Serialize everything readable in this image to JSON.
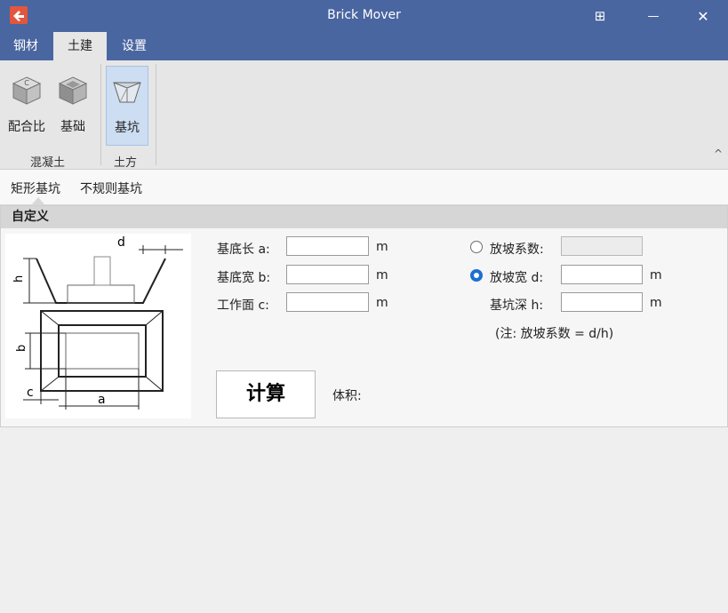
{
  "window": {
    "title": "Brick Mover",
    "restore_glyph": "⊞",
    "minimize_glyph": "—",
    "close_glyph": "✕"
  },
  "tabs": [
    {
      "label": "钢材"
    },
    {
      "label": "土建",
      "active": true
    },
    {
      "label": "设置"
    }
  ],
  "ribbon": {
    "buttons": [
      {
        "label": "配合比"
      },
      {
        "label": "基础"
      },
      {
        "label": "基坑",
        "selected": true
      }
    ],
    "groups": [
      {
        "label": "混凝土"
      },
      {
        "label": "土方"
      }
    ],
    "collapse_glyph": "^"
  },
  "subtabs": [
    {
      "label": "矩形基坑",
      "active": true
    },
    {
      "label": "不规则基坑"
    }
  ],
  "panel": {
    "header": "自定义",
    "diagram_labels": {
      "d": "d",
      "h": "h",
      "b": "b",
      "c": "c",
      "a": "a"
    },
    "fields": {
      "length": {
        "label": "基底长 a:",
        "value": "",
        "unit": "m"
      },
      "width": {
        "label": "基底宽 b:",
        "value": "",
        "unit": "m"
      },
      "workface": {
        "label": "工作面 c:",
        "value": "",
        "unit": "m"
      },
      "slope_coef": {
        "label": "放坡系数:",
        "value": "",
        "checked": false
      },
      "slope_width": {
        "label": "放坡宽 d:",
        "value": "",
        "unit": "m",
        "checked": true
      },
      "pit_depth": {
        "label": "基坑深 h:",
        "value": "",
        "unit": "m"
      }
    },
    "note": "(注: 放坡系数 = d/h)",
    "calc_button": "计算",
    "volume_label": "体积:"
  },
  "colors": {
    "titlebar": "#4a66a1",
    "accent": "#1f6fd1"
  }
}
